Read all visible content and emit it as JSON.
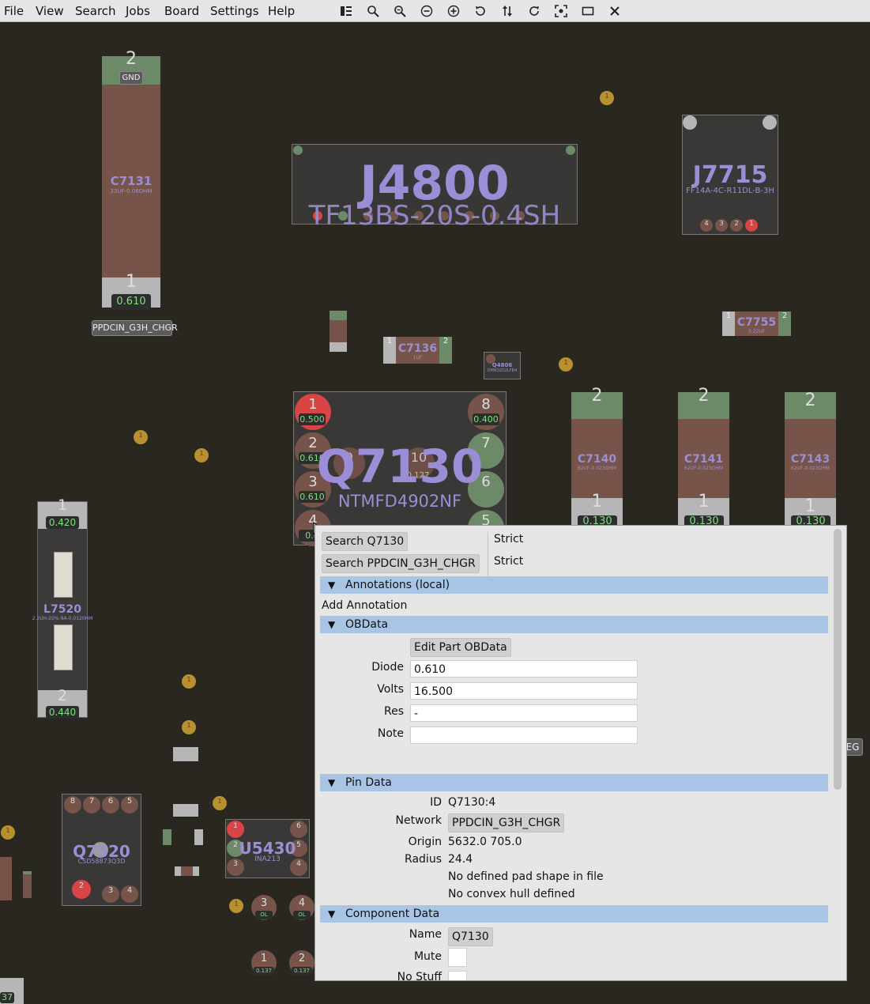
{
  "menu": {
    "file": "File",
    "view": "View",
    "search": "Search",
    "jobs": "Jobs",
    "board": "Board",
    "settings": "Settings",
    "help": "Help"
  },
  "toolbar": [
    {
      "icon": "toggle-sidebar-icon"
    },
    {
      "icon": "zoom-fit-icon"
    },
    {
      "icon": "zoom-in-icon"
    },
    {
      "icon": "zoom-out-icon"
    },
    {
      "icon": "zoom-plus-icon"
    },
    {
      "icon": "rotate-ccw-icon"
    },
    {
      "icon": "flip-icon"
    },
    {
      "icon": "rotate-cw-icon"
    },
    {
      "icon": "center-icon"
    },
    {
      "icon": "layer-icon"
    },
    {
      "icon": "close-icon"
    }
  ],
  "board": {
    "c7131": {
      "name": "C7131",
      "value": "33UF-0.06OHM",
      "pin_top": "2",
      "pin_bottom": "1",
      "top_net": "GND",
      "voltage": "0.610",
      "net_label": "PPDCIN_G3H_CHGR"
    },
    "j4800": {
      "name": "J4800",
      "value": "TF13BS-20S-0.4SH"
    },
    "j7715": {
      "name": "J7715",
      "value": "FF14A-4C-R11DL-B-3H",
      "pins": [
        "4",
        "3",
        "2",
        "1"
      ]
    },
    "c7136": {
      "name": "C7136",
      "value": "1UF",
      "pin_left": "1",
      "pin_right": "2"
    },
    "c7755": {
      "name": "C7755",
      "value": "0.22UF",
      "pin_left": "1",
      "pin_right": "2"
    },
    "q4806": {
      "name": "Q4806",
      "value": "DMN32D2LFB4"
    },
    "q7130": {
      "name": "Q7130",
      "value": "NTMFD4902NF",
      "pins": [
        {
          "n": "1",
          "v": "0.500"
        },
        {
          "n": "2",
          "v": "0.610"
        },
        {
          "n": "3",
          "v": "0.610"
        },
        {
          "n": "4",
          "v": "0.6"
        },
        {
          "n": "8",
          "v": "0.400"
        },
        {
          "n": "7",
          "v": ""
        },
        {
          "n": "6",
          "v": ""
        },
        {
          "n": "5",
          "v": ""
        },
        {
          "n": "9",
          "v": "0.6"
        },
        {
          "n": "10",
          "v": "0.127"
        }
      ]
    },
    "c7140": {
      "name": "C7140",
      "value": "62UF-0.023OHM",
      "pin_top": "2",
      "pin_bottom": "1",
      "voltage": "0.130"
    },
    "c7141": {
      "name": "C7141",
      "value": "62UF-0.023OHM",
      "pin_top": "2",
      "pin_bottom": "1",
      "voltage": "0.130"
    },
    "c7143": {
      "name": "C7143",
      "value": "62UF-0.023OHM",
      "pin_top": "2",
      "pin_bottom": "1",
      "voltage": "0.130"
    },
    "l7520": {
      "name": "L7520",
      "value": "2.2UH-20%-9A-0.0120HM",
      "pin_top": "1",
      "pin_bottom": "2",
      "v_top": "0.420",
      "v_bottom": "0.440"
    },
    "q7520": {
      "name": "Q7520",
      "value": "CSD58873Q3D",
      "pins_top": [
        "8",
        "7",
        "6",
        "5"
      ],
      "pins_bottom": [
        "2",
        "3",
        "4"
      ]
    },
    "u5430": {
      "name": "U5430",
      "value": "INA213",
      "pins": [
        "1",
        "2",
        "3",
        "6",
        "5",
        "4"
      ]
    },
    "misc": {
      "pin_a": "3",
      "pin_b": "4",
      "ol": "OL",
      "pin_c": "1",
      "pin_d": "2",
      "v_small": "0.137",
      "edge_left": "37",
      "edge_right": "EG",
      "via_label": "1"
    }
  },
  "panel": {
    "search_part_btn": "Search Q7130",
    "search_part_mode": "Strict",
    "search_net_btn": "Search PPDCIN_G3H_CHGR",
    "search_net_mode": "Strict",
    "annotations_header": "Annotations (local)",
    "add_annotation": "Add Annotation",
    "obdata_header": "OBData",
    "edit_obdata_btn": "Edit Part OBData",
    "diode_label": "Diode",
    "diode_value": "0.610",
    "volts_label": "Volts",
    "volts_value": "16.500",
    "res_label": "Res",
    "res_value": "-",
    "note_label": "Note",
    "note_value": "",
    "pindata_header": "Pin Data",
    "id_label": "ID",
    "id_value": "Q7130:4",
    "network_label": "Network",
    "network_value": "PPDCIN_G3H_CHGR",
    "origin_label": "Origin",
    "origin_value": "5632.0 705.0",
    "radius_label": "Radius",
    "radius_value": "24.4",
    "pad_note": "No defined pad shape in file",
    "hull_note": "No convex hull defined",
    "component_header": "Component Data",
    "name_label": "Name",
    "name_value": "Q7130",
    "mute_label": "Mute",
    "nostuff_label": "No Stuff"
  }
}
